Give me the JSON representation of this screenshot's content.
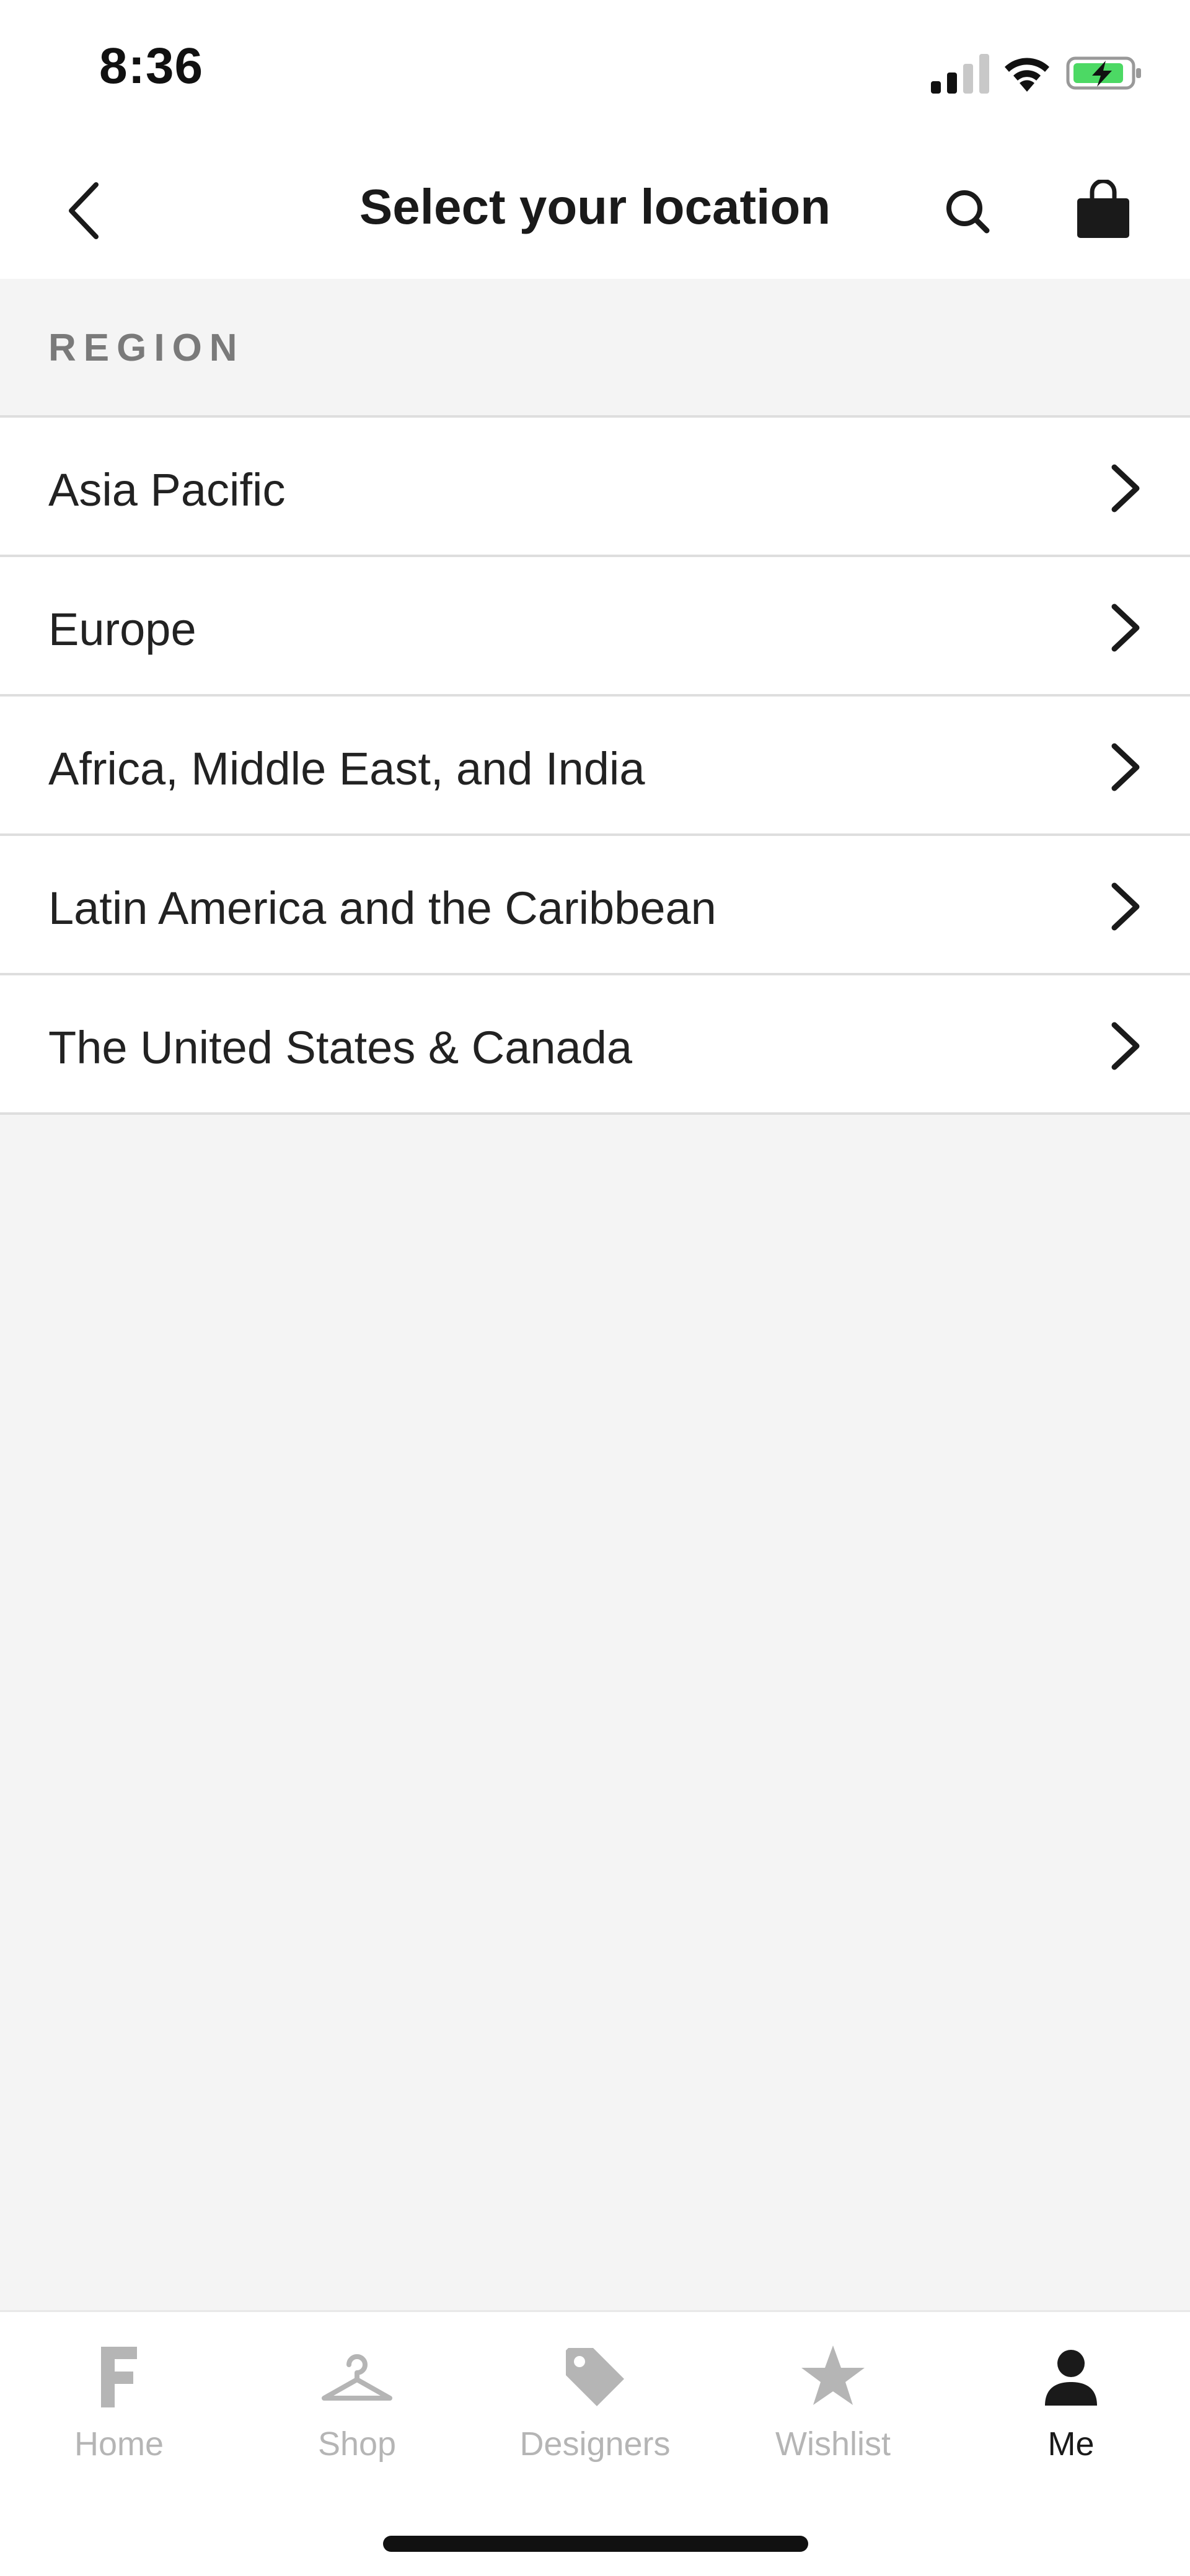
{
  "status_bar": {
    "time": "8:36",
    "icons": [
      "cellular-signal-icon",
      "wifi-icon",
      "battery-charging-icon"
    ]
  },
  "nav": {
    "title": "Select your location",
    "back_icon": "chevron-left-icon",
    "search_icon": "search-icon",
    "bag_icon": "shopping-bag-icon"
  },
  "region": {
    "header": "REGION",
    "items": [
      {
        "label": "Asia Pacific"
      },
      {
        "label": "Europe"
      },
      {
        "label": "Africa, Middle East, and India"
      },
      {
        "label": "Latin America and the Caribbean"
      },
      {
        "label": "The United States & Canada"
      }
    ]
  },
  "tabbar": {
    "tabs": [
      {
        "label": "Home",
        "icon": "farfetch-f-icon",
        "active": false
      },
      {
        "label": "Shop",
        "icon": "hanger-icon",
        "active": false
      },
      {
        "label": "Designers",
        "icon": "tag-icon",
        "active": false
      },
      {
        "label": "Wishlist",
        "icon": "star-icon",
        "active": false
      },
      {
        "label": "Me",
        "icon": "person-icon",
        "active": true
      }
    ]
  },
  "colors": {
    "background": "#f4f4f4",
    "surface": "#ffffff",
    "divider": "#dedede",
    "text": "#222222",
    "muted": "#7a7a7a",
    "tab_inactive": "#b5b5b5",
    "battery_green": "#4cd964"
  }
}
